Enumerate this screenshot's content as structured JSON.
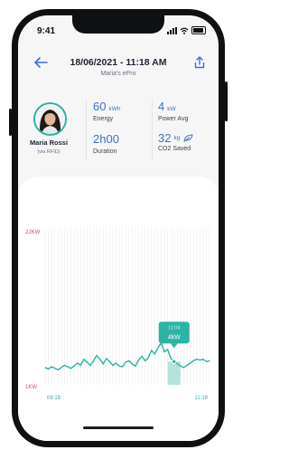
{
  "status_bar": {
    "time": "9:41"
  },
  "header": {
    "title": "18/06/2021 - 11:18 AM",
    "subtitle": "Maria's ePro",
    "back_icon": "arrow-left-icon",
    "share_icon": "share-icon"
  },
  "user": {
    "name": "Maria Rossi",
    "via": "(via RFID)"
  },
  "stats": {
    "energy": {
      "value": "60",
      "unit": "kWh",
      "label": "Energy"
    },
    "power": {
      "value": "4",
      "unit": "kW",
      "label": "Power Avg"
    },
    "duration": {
      "value": "2h00",
      "label": "Duration"
    },
    "co2": {
      "value": "32",
      "unit": "kg",
      "label": "CO2 Saved",
      "icon": "leaf-icon"
    }
  },
  "colors": {
    "accent": "#2bb3a5",
    "primary": "#3c6fd4",
    "axis_y": "#d9457f"
  },
  "chart_data": {
    "type": "line",
    "y_top_label": "22KW",
    "y_bottom_label": "1KW",
    "x_start_label": "09:18",
    "x_end_label": "11:18",
    "ylim": [
      1,
      22
    ],
    "tooltip": {
      "time": "11:04",
      "value": "4kW"
    },
    "highlight_index": 40,
    "values": [
      3.3,
      3.1,
      3.4,
      3.2,
      3.0,
      3.3,
      3.6,
      3.4,
      3.2,
      3.5,
      3.9,
      3.6,
      4.4,
      4.0,
      3.6,
      4.2,
      4.9,
      4.4,
      3.8,
      4.5,
      4.1,
      3.6,
      3.9,
      3.5,
      3.4,
      4.0,
      4.2,
      3.8,
      3.5,
      4.3,
      4.8,
      4.2,
      4.6,
      5.6,
      5.1,
      5.9,
      6.6,
      5.4,
      5.7,
      4.5,
      4.1,
      3.8,
      3.5,
      3.3,
      3.6,
      3.9,
      4.2,
      4.4,
      4.3,
      4.4,
      4.1,
      4.2
    ]
  }
}
